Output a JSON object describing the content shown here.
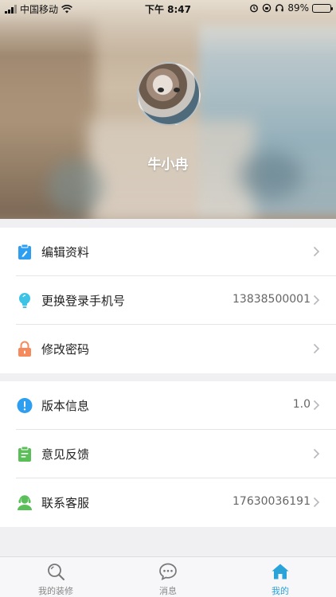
{
  "status_bar": {
    "carrier": "中国移动",
    "time": "下午 8:47",
    "battery_percent_text": "89%",
    "battery_level": 0.89
  },
  "profile": {
    "username": "牛小冉"
  },
  "menu": {
    "group1": [
      {
        "label": "编辑资料",
        "value": "",
        "icon": "clipboard-edit-icon"
      },
      {
        "label": "更换登录手机号",
        "value": "13838500001",
        "icon": "lightbulb-icon"
      },
      {
        "label": "修改密码",
        "value": "",
        "icon": "lock-icon"
      }
    ],
    "group2": [
      {
        "label": "版本信息",
        "value": "1.0",
        "icon": "info-icon"
      },
      {
        "label": "意见反馈",
        "value": "",
        "icon": "feedback-clipboard-icon"
      },
      {
        "label": "联系客服",
        "value": "17630036191",
        "icon": "customer-service-icon"
      }
    ]
  },
  "tabs": [
    {
      "label": "我的装修",
      "icon": "search-icon",
      "active": false
    },
    {
      "label": "消息",
      "icon": "chat-icon",
      "active": false
    },
    {
      "label": "我的",
      "icon": "home-icon",
      "active": true
    }
  ],
  "colors": {
    "accent": "#2aa3d8",
    "icon_blue": "#2e9ff0",
    "icon_cyan": "#3cc3e6",
    "icon_orange": "#f58b5c",
    "icon_green": "#5bbf59"
  }
}
